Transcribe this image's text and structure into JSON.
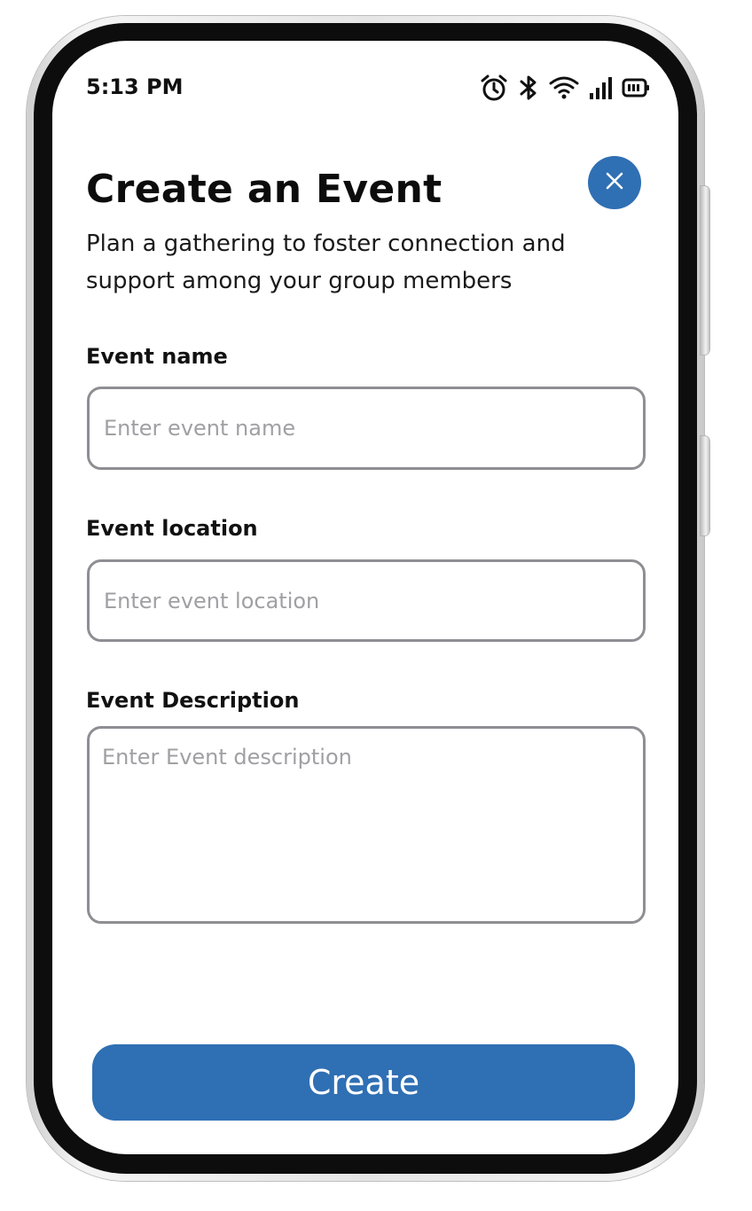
{
  "status_bar": {
    "time": "5:13 PM",
    "icons": [
      "alarm-icon",
      "bluetooth-icon",
      "wifi-icon",
      "signal-icon",
      "battery-icon"
    ]
  },
  "header": {
    "title": "Create an Event",
    "subtitle": "Plan a gathering to foster connection and support among your group members",
    "close_icon": "close-icon"
  },
  "form": {
    "event_name": {
      "label": "Event name",
      "value": "",
      "placeholder": "Enter event name"
    },
    "event_location": {
      "label": "Event location",
      "value": "",
      "placeholder": "Enter event location"
    },
    "event_description": {
      "label": "Event Description",
      "value": "",
      "placeholder": "Enter Event description"
    }
  },
  "actions": {
    "create_label": "Create"
  },
  "colors": {
    "accent": "#2f6fb3",
    "border": "#8e8e93",
    "placeholder": "#a0a0a4",
    "text": "#111111"
  }
}
